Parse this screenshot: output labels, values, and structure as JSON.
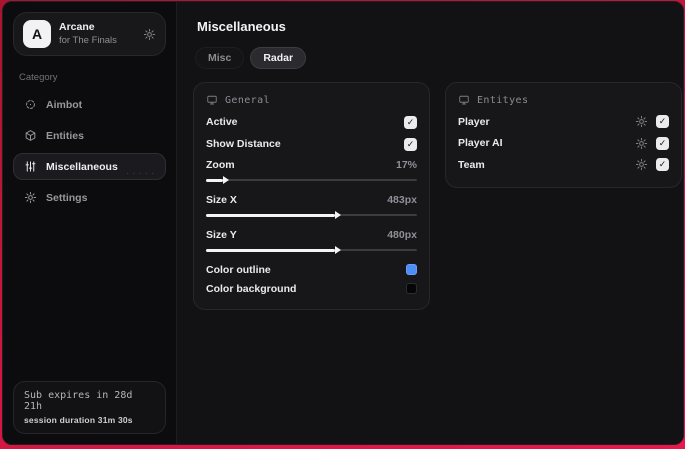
{
  "app": {
    "backdrop_color": "#cf1640",
    "profile": {
      "avatar_letter": "A",
      "name": "Arcane",
      "subtitle": "for The Finals"
    },
    "sidebar": {
      "category_label": "Category",
      "items": [
        {
          "label": "Aimbot",
          "icon": "crosshair-icon",
          "active": false
        },
        {
          "label": "Entities",
          "icon": "cube-icon",
          "active": false
        },
        {
          "label": "Miscellaneous",
          "icon": "sliders-icon",
          "active": true
        },
        {
          "label": "Settings",
          "icon": "gear-icon",
          "active": false
        }
      ],
      "footer": {
        "subscription": "Sub expires in 28d 21h",
        "session": "session duration 31m 30s"
      }
    },
    "main": {
      "page_title": "Miscellaneous",
      "tabs": [
        {
          "label": "Misc",
          "active": false
        },
        {
          "label": "Radar",
          "active": true
        }
      ],
      "general_panel": {
        "title": "General",
        "icon": "monitor-icon",
        "toggles": [
          {
            "label": "Active",
            "checked": true
          },
          {
            "label": "Show Distance",
            "checked": true
          }
        ],
        "sliders": [
          {
            "label": "Zoom",
            "value": "17%",
            "fill_pct": 8
          },
          {
            "label": "Size X",
            "value": "483px",
            "fill_pct": 61
          },
          {
            "label": "Size Y",
            "value": "480px",
            "fill_pct": 61
          }
        ],
        "colors": [
          {
            "label": "Color outline",
            "swatch": "#4d8df6"
          },
          {
            "label": "Color background",
            "swatch": "#050507"
          }
        ]
      },
      "entities_panel": {
        "title": "Entityes",
        "icon": "monitor-icon",
        "rows": [
          {
            "label": "Player",
            "checked": true,
            "config_icon": "gear-icon"
          },
          {
            "label": "Player AI",
            "checked": true,
            "config_icon": "gear-icon"
          },
          {
            "label": "Team",
            "checked": true,
            "config_icon": "gear-icon"
          }
        ]
      }
    }
  }
}
